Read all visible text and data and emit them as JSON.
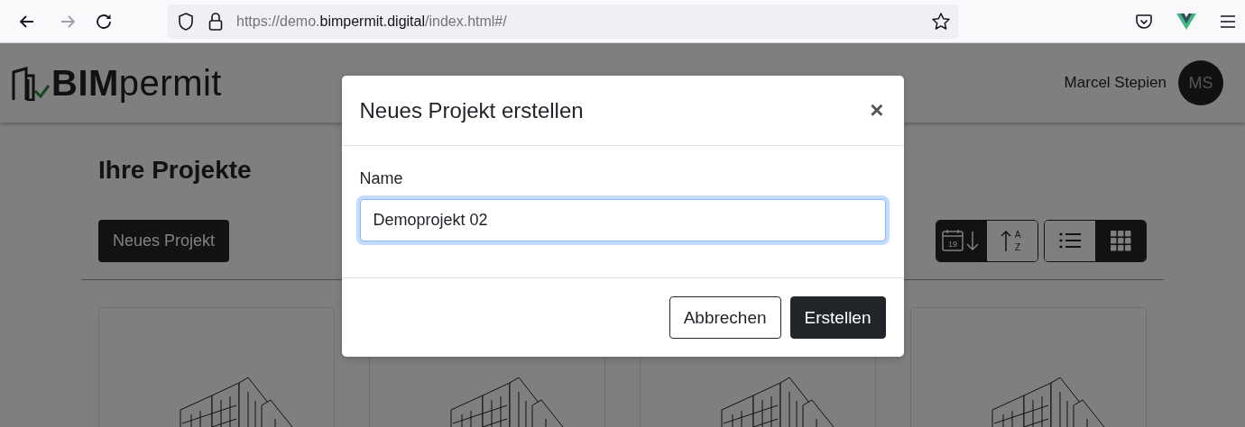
{
  "browser": {
    "back_enabled": true,
    "forward_enabled": false,
    "url": "https://demo.**bimpermit.digital**/index.html#/"
  },
  "header": {
    "logo": "**BIM**permit",
    "user_name": "Marcel Stepien",
    "avatar_initials": "MS"
  },
  "page": {
    "title": "Ihre Projekte",
    "new_project_button": "Neues Projekt",
    "sort_buttons": [
      {
        "kind": "date",
        "label": "19",
        "selected": true
      },
      {
        "kind": "alpha",
        "letters": [
          "A",
          "Z"
        ],
        "selected": false
      }
    ],
    "view_buttons": [
      {
        "kind": "list",
        "selected": false
      },
      {
        "kind": "grid",
        "selected": true
      }
    ]
  },
  "dialog": {
    "open": true,
    "title": "Neues Projekt erstellen",
    "close_symbol": "×",
    "field_label": "Name",
    "field_value": "Demoprojekt 02",
    "focused": true,
    "buttons": [
      {
        "kind": "secondary",
        "label": "Abbrechen"
      },
      {
        "kind": "primary",
        "label": "Erstellen"
      }
    ]
  }
}
